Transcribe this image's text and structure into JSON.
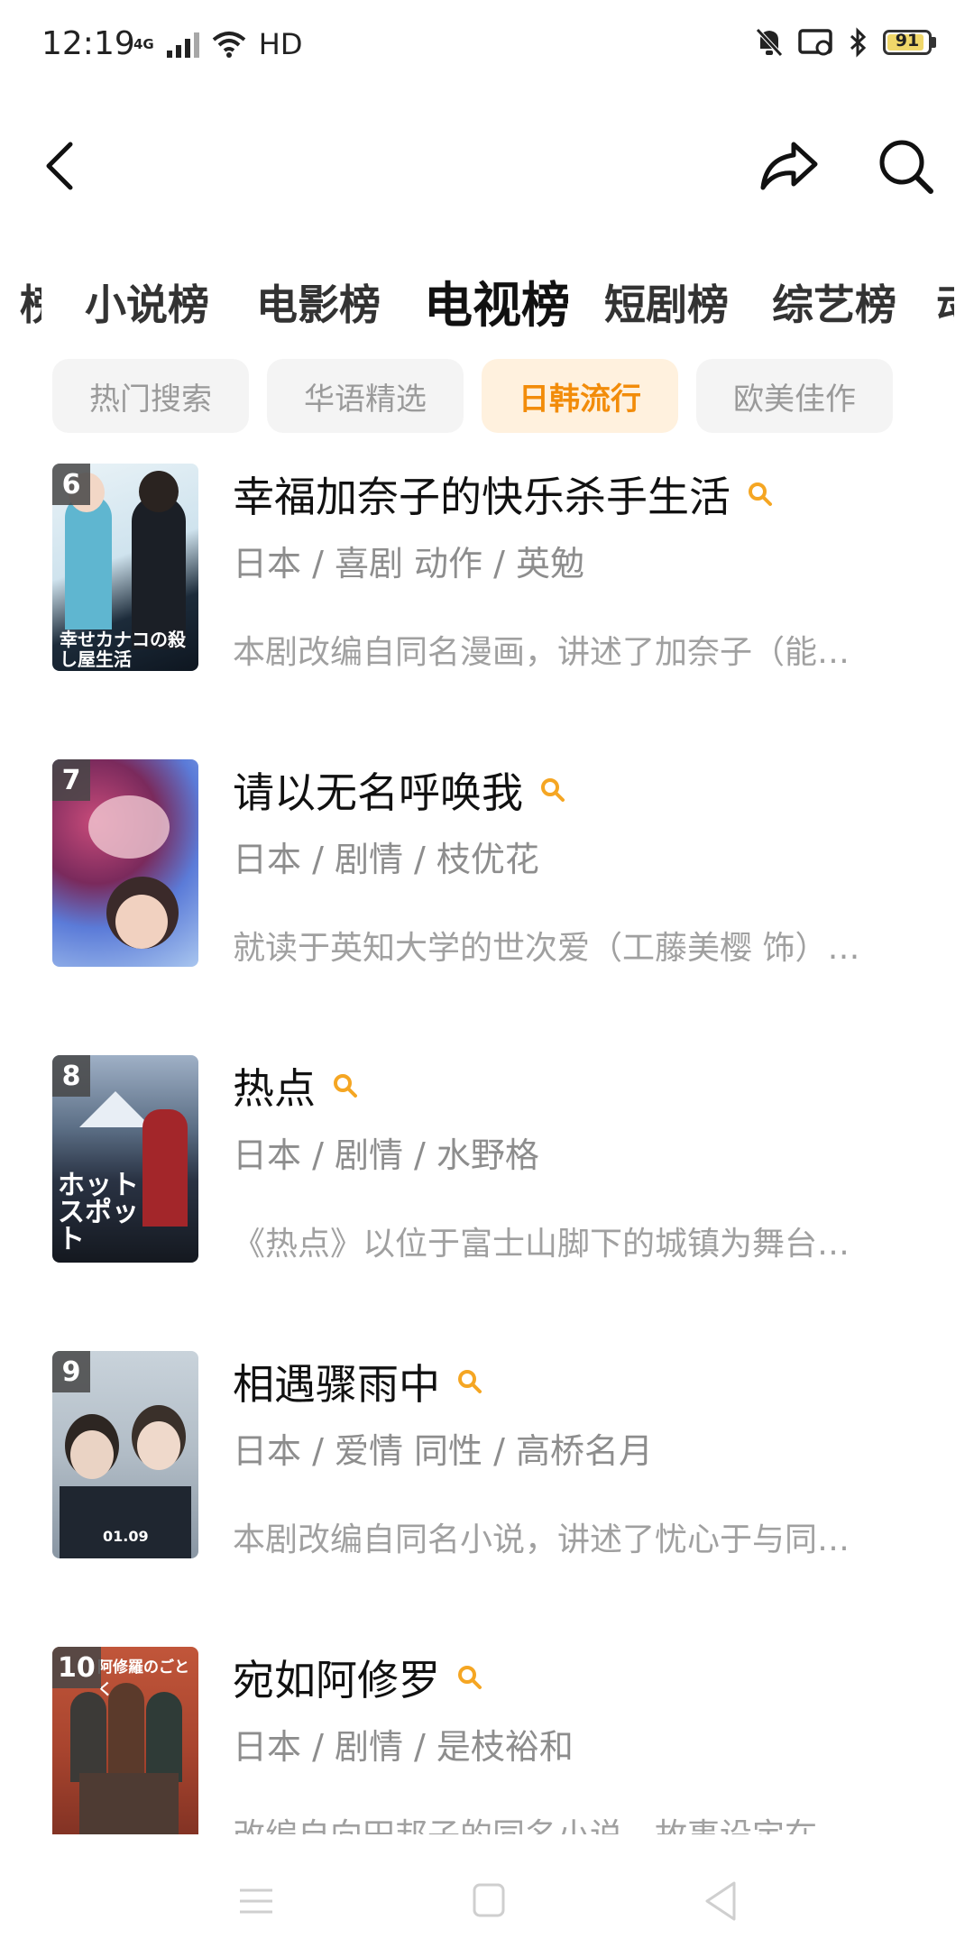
{
  "status_bar": {
    "time": "12:19",
    "network": "4G",
    "hd": "HD",
    "battery": "91",
    "battery_percent": 91
  },
  "header": {
    "back_icon": "chevron-left-icon",
    "share_icon": "share-icon",
    "search_icon": "search-icon"
  },
  "tabs": [
    {
      "label": "小说榜",
      "active": false
    },
    {
      "label": "电影榜",
      "active": false
    },
    {
      "label": "电视榜",
      "active": true
    },
    {
      "label": "短剧榜",
      "active": false
    },
    {
      "label": "综艺榜",
      "active": false
    }
  ],
  "chips": [
    {
      "label": "热门搜索",
      "active": false
    },
    {
      "label": "华语精选",
      "active": false
    },
    {
      "label": "日韩流行",
      "active": true
    },
    {
      "label": "欧美佳作",
      "active": false
    }
  ],
  "items": [
    {
      "rank": "6",
      "title": "幸福加奈子的快乐杀手生活",
      "meta": "日本 / 喜剧 动作 / 英勉",
      "desc": "本剧改编自同名漫画，讲述了加奈子（能…",
      "poster_text": "幸せカナコの殺し屋生活"
    },
    {
      "rank": "7",
      "title": "请以无名呼唤我",
      "meta": "日本 / 剧情 / 枝优花",
      "desc": "就读于英知大学的世次爱（工藤美樱 饰）…",
      "poster_text": ""
    },
    {
      "rank": "8",
      "title": "热点",
      "meta": "日本 / 剧情 / 水野格",
      "desc": "《热点》以位于富士山脚下的城镇为舞台…",
      "poster_text": "ホットスポット"
    },
    {
      "rank": "9",
      "title": "相遇骤雨中",
      "meta": "日本 / 爱情 同性 / 高桥名月",
      "desc": "本剧改编自同名小说，讲述了忧心于与同…",
      "poster_text": "01.09"
    },
    {
      "rank": "10",
      "title": "宛如阿修罗",
      "meta": "日本 / 剧情 / 是枝裕和",
      "desc": "改编自向田邦子的同名小说，故事设定在…",
      "poster_text": "阿修羅のごとく"
    }
  ],
  "colors": {
    "accent": "#f28c0a",
    "search_mark": "#f5a623"
  },
  "navbar": {
    "menu_icon": "menu-icon",
    "home_icon": "home-square-icon",
    "back_icon": "back-triangle-icon"
  }
}
